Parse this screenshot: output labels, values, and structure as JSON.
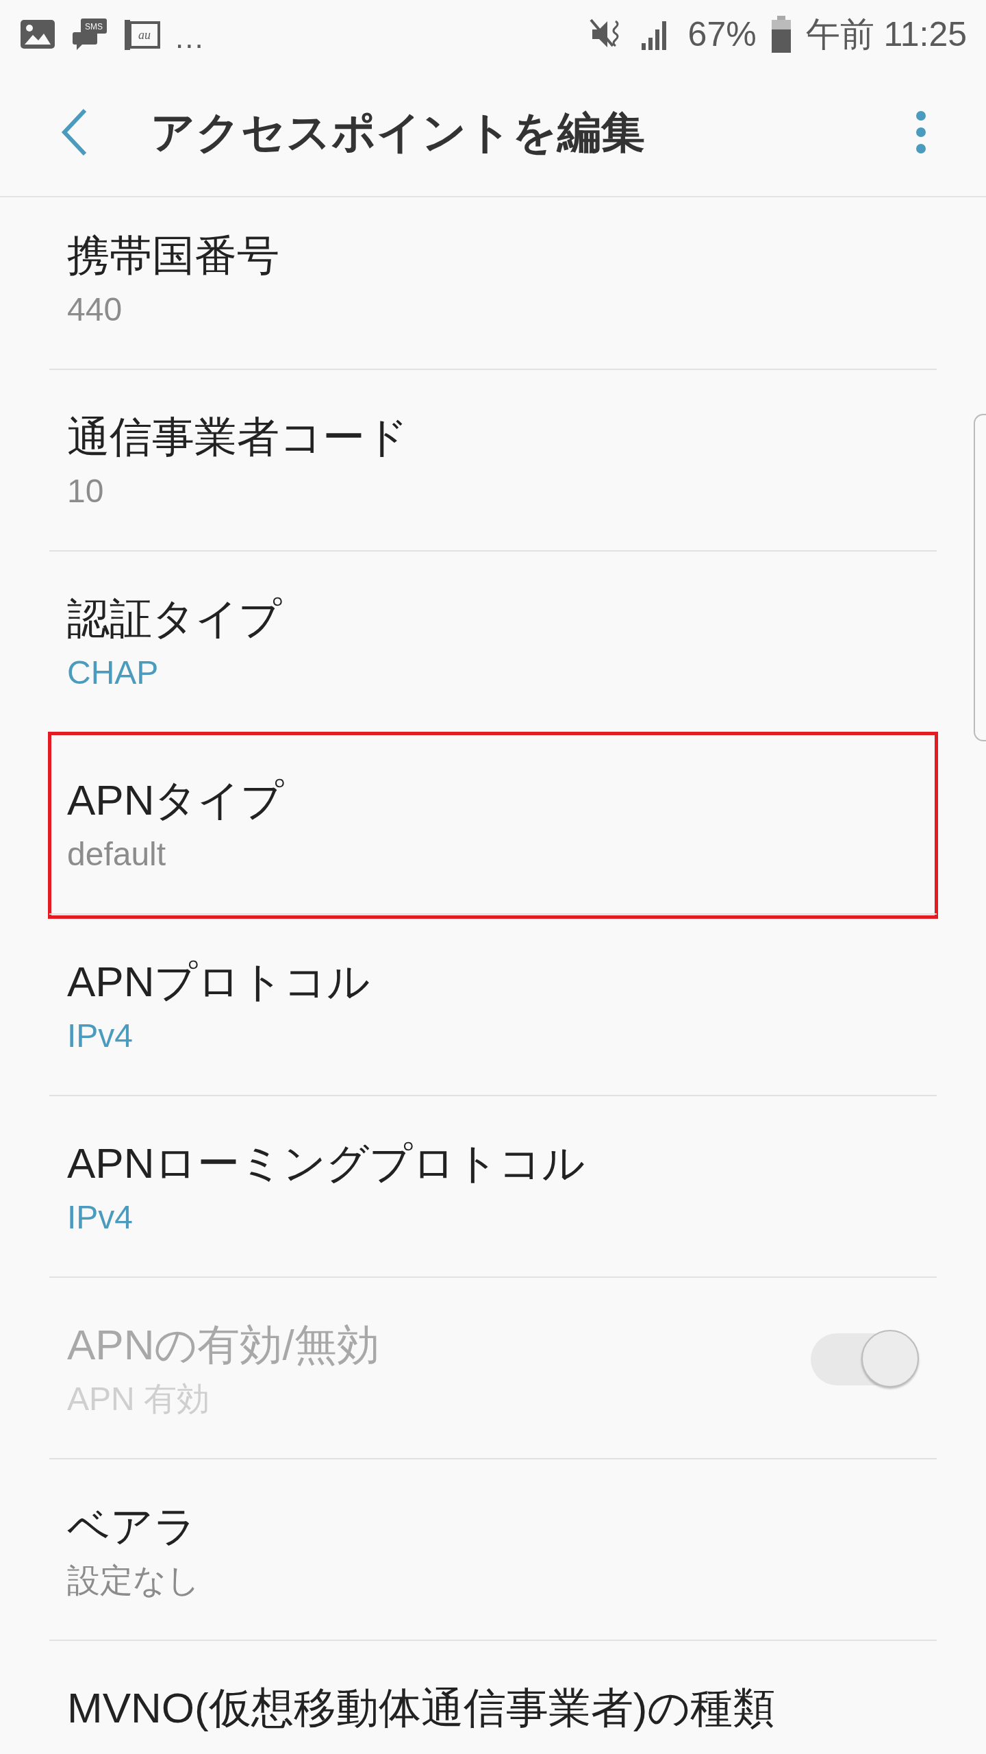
{
  "status_bar": {
    "notification_icons": [
      {
        "kind": "picture"
      },
      {
        "kind": "sms",
        "label": "SMS"
      },
      {
        "kind": "carrier",
        "label": "au"
      }
    ],
    "overflow": "...",
    "battery": "67%",
    "time": "午前 11:25"
  },
  "header": {
    "title": "アクセスポイントを編集"
  },
  "rows": [
    {
      "kind": "text",
      "title": "携帯国番号",
      "value": "440",
      "highlighted": false
    },
    {
      "kind": "text",
      "title": "通信事業者コード",
      "value": "10",
      "highlighted": false
    },
    {
      "kind": "list",
      "title": "認証タイプ",
      "value": "CHAP",
      "highlighted": false
    },
    {
      "kind": "text",
      "title": "APNタイプ",
      "value": "default",
      "highlighted": true
    },
    {
      "kind": "list",
      "title": "APNプロトコル",
      "value": "IPv4",
      "highlighted": false
    },
    {
      "kind": "list",
      "title": "APNローミングプロトコル",
      "value": "IPv4",
      "highlighted": false
    },
    {
      "kind": "switch",
      "title": "APNの有効/無効",
      "value": "APN 有効",
      "on": true,
      "disabled": true,
      "highlighted": false
    },
    {
      "kind": "text",
      "title": "ベアラ",
      "value": "設定なし",
      "highlighted": false
    },
    {
      "kind": "title",
      "title": "MVNO(仮想移動体通信事業者)の種類",
      "highlighted": false
    }
  ]
}
